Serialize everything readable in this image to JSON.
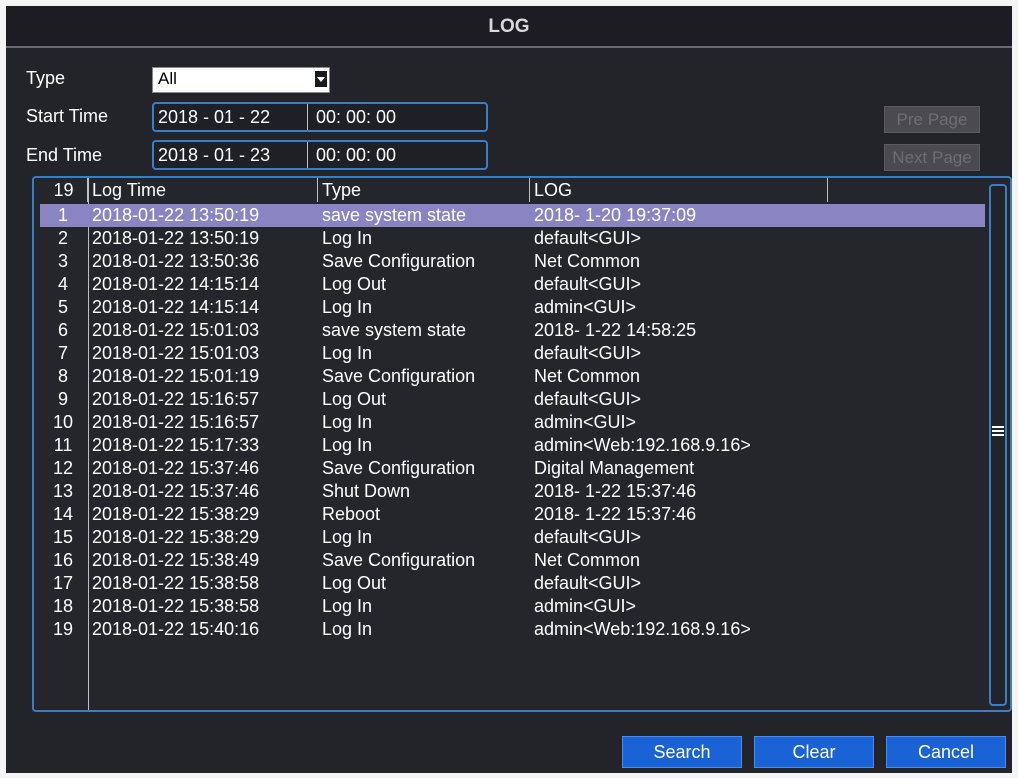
{
  "window": {
    "title": "LOG"
  },
  "filters": {
    "type_label": "Type",
    "type_value": "All",
    "start_label": "Start Time",
    "start_date": "2018 - 01 - 22",
    "start_time": "00: 00: 00",
    "end_label": "End Time",
    "end_date": "2018 - 01 - 23",
    "end_time": "00: 00: 00"
  },
  "paging": {
    "pre_label": "Pre Page",
    "next_label": "Next Page"
  },
  "table": {
    "count": "19",
    "headers": {
      "log_time": "Log Time",
      "type": "Type",
      "log": "LOG"
    },
    "rows": [
      {
        "n": "1",
        "time": "2018-01-22 13:50:19",
        "type": "save system state",
        "log": "2018- 1-20 19:37:09"
      },
      {
        "n": "2",
        "time": "2018-01-22 13:50:19",
        "type": "Log In",
        "log": "default<GUI>"
      },
      {
        "n": "3",
        "time": "2018-01-22 13:50:36",
        "type": "Save Configuration",
        "log": "Net Common"
      },
      {
        "n": "4",
        "time": "2018-01-22 14:15:14",
        "type": "Log Out",
        "log": "default<GUI>"
      },
      {
        "n": "5",
        "time": "2018-01-22 14:15:14",
        "type": "Log In",
        "log": "admin<GUI>"
      },
      {
        "n": "6",
        "time": "2018-01-22 15:01:03",
        "type": "save system state",
        "log": "2018- 1-22 14:58:25"
      },
      {
        "n": "7",
        "time": "2018-01-22 15:01:03",
        "type": "Log In",
        "log": "default<GUI>"
      },
      {
        "n": "8",
        "time": "2018-01-22 15:01:19",
        "type": "Save Configuration",
        "log": "Net Common"
      },
      {
        "n": "9",
        "time": "2018-01-22 15:16:57",
        "type": "Log Out",
        "log": "default<GUI>"
      },
      {
        "n": "10",
        "time": "2018-01-22 15:16:57",
        "type": "Log In",
        "log": "admin<GUI>"
      },
      {
        "n": "11",
        "time": "2018-01-22 15:17:33",
        "type": "Log In",
        "log": "admin<Web:192.168.9.16>"
      },
      {
        "n": "12",
        "time": "2018-01-22 15:37:46",
        "type": "Save Configuration",
        "log": "Digital Management"
      },
      {
        "n": "13",
        "time": "2018-01-22 15:37:46",
        "type": "Shut Down",
        "log": "2018- 1-22 15:37:46"
      },
      {
        "n": "14",
        "time": "2018-01-22 15:38:29",
        "type": "Reboot",
        "log": "2018- 1-22 15:37:46"
      },
      {
        "n": "15",
        "time": "2018-01-22 15:38:29",
        "type": "Log In",
        "log": "default<GUI>"
      },
      {
        "n": "16",
        "time": "2018-01-22 15:38:49",
        "type": "Save Configuration",
        "log": "Net Common"
      },
      {
        "n": "17",
        "time": "2018-01-22 15:38:58",
        "type": "Log Out",
        "log": "default<GUI>"
      },
      {
        "n": "18",
        "time": "2018-01-22 15:38:58",
        "type": "Log In",
        "log": "admin<GUI>"
      },
      {
        "n": "19",
        "time": "2018-01-22 15:40:16",
        "type": "Log In",
        "log": "admin<Web:192.168.9.16>"
      }
    ],
    "selected_row": 1
  },
  "buttons": {
    "search": "Search",
    "clear": "Clear",
    "cancel": "Cancel"
  },
  "colors": {
    "accent": "#3a7ec8",
    "selection": "#8a84c2",
    "button": "#1a63d6",
    "background": "#23232a"
  }
}
